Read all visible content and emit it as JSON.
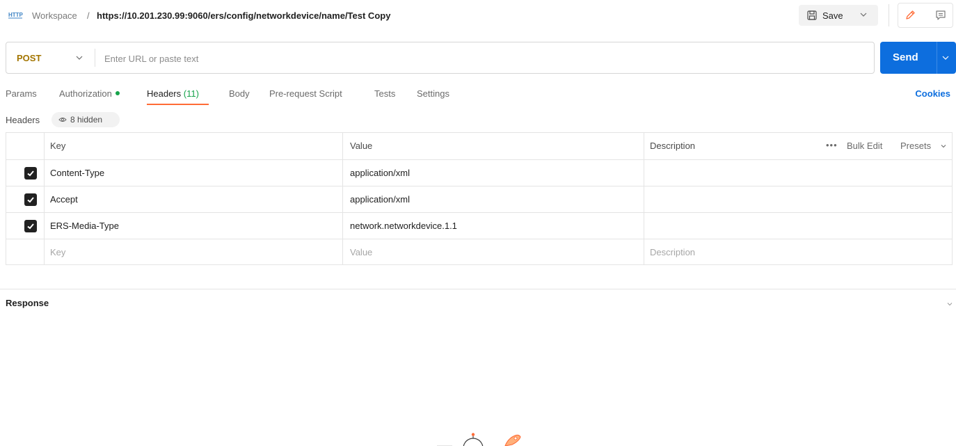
{
  "breadcrumb": {
    "workspace": "Workspace",
    "separator": "/",
    "url": "https://10.201.230.99:9060/ers/config/networkdevice/name/Test Copy"
  },
  "toolbar": {
    "save_label": "Save"
  },
  "request": {
    "method": "POST",
    "url_placeholder": "Enter URL or paste text",
    "send_label": "Send"
  },
  "tabs": [
    {
      "label": "Params"
    },
    {
      "label": "Authorization"
    },
    {
      "label": "Headers",
      "count": "(11)"
    },
    {
      "label": "Body"
    },
    {
      "label": "Pre-request Script"
    },
    {
      "label": "Tests"
    },
    {
      "label": "Settings"
    }
  ],
  "cookies_label": "Cookies",
  "headers_section": {
    "label": "Headers",
    "hidden_label": "8 hidden"
  },
  "table": {
    "columns": [
      "Key",
      "Value",
      "Description"
    ],
    "actions": {
      "more": "•••",
      "bulk_edit": "Bulk Edit",
      "presets": "Presets"
    },
    "rows": [
      {
        "key": "Content-Type",
        "value": "application/xml",
        "description": "",
        "checked": true
      },
      {
        "key": "Accept",
        "value": "application/xml",
        "description": "",
        "checked": true
      },
      {
        "key": "ERS-Media-Type",
        "value": "network.networkdevice.1.1",
        "description": "",
        "checked": true
      }
    ],
    "placeholders": {
      "key": "Key",
      "value": "Value",
      "description": "Description"
    }
  },
  "response": {
    "label": "Response"
  },
  "colors": {
    "accent": "#ff6c37",
    "send": "#0d6ede",
    "method": "#a37500",
    "active_count": "#16a34a"
  }
}
